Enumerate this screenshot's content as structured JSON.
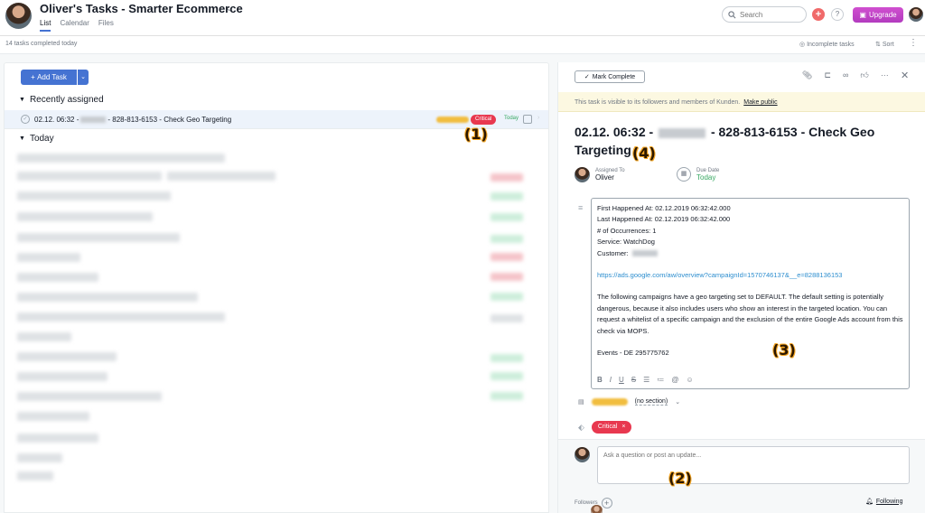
{
  "header": {
    "project_title": "Oliver's Tasks - Smarter Ecommerce",
    "tabs": [
      "List",
      "Calendar",
      "Files"
    ],
    "search_placeholder": "Search",
    "plus_label": "+",
    "help_label": "?",
    "upgrade_label": "Upgrade"
  },
  "subheader": {
    "completed_count": "14 tasks completed today",
    "incomplete_label": "Incomplete tasks",
    "sort_label": "Sort"
  },
  "list": {
    "add_task_label": "Add Task",
    "sections": [
      "Recently assigned",
      "Today"
    ],
    "task": {
      "prefix": "02.12. 06:32 -",
      "suffix": "- 828-813-6153 - Check Geo Targeting",
      "tag": "Critical",
      "due": "Today"
    }
  },
  "detail": {
    "mark_complete_label": "Mark Complete",
    "visibility_text": "This task is visible to its followers and members of Kunden.",
    "visibility_link": "Make public",
    "title_prefix": "02.12. 06:32 -",
    "title_suffix": "- 828-813-6153 - Check Geo Targeting",
    "assigned_to_label": "Assigned To",
    "assignee": "Oliver",
    "due_date_label": "Due Date",
    "due_date": "Today",
    "description": {
      "first_happened": "First Happened At: 02.12.2019 06:32:42.000",
      "last_happened": "Last Happened At: 02.12.2019 06:32:42.000",
      "occurrences": "# of Occurrences: 1",
      "service": "Service: WatchDog",
      "customer": "Customer:",
      "link": "https://ads.google.com/aw/overview?campaignId=1570746137&__e=8288136153",
      "body": "The following campaigns have a geo targeting set to DEFAULT. The default setting is potentially dangerous, because it also includes users who show an interest in the targeted location. You can request a whitelist of a specific campaign and the exclusion of the entire Google Ads account from this check via MOPS.",
      "events": "Events - DE 295775762"
    },
    "section_select": "(no section)",
    "tag": "Critical",
    "comment_placeholder": "Ask a question or post an update...",
    "followers_label": "Followers",
    "following_label": "Following"
  },
  "callouts": [
    "(1)",
    "(2)",
    "(3)",
    "(4)"
  ],
  "colors": {
    "accent": "#4573d2",
    "critical": "#e8384f",
    "today": "#37a862",
    "upgrade": "#c24bc9"
  }
}
